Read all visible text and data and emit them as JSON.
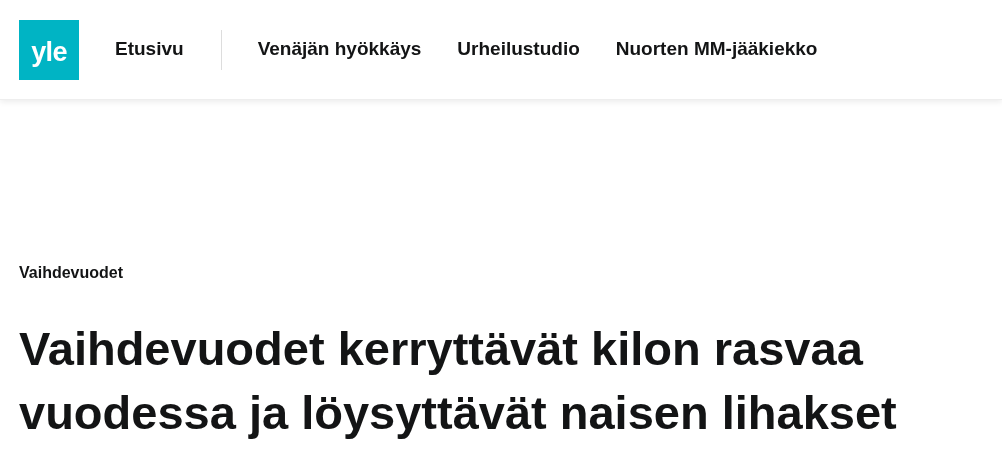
{
  "header": {
    "logo": "yle",
    "nav": [
      {
        "label": "Etusivu",
        "kind": "home"
      },
      {
        "label": "Venäjän hyökkäys",
        "kind": "topic"
      },
      {
        "label": "Urheilustudio",
        "kind": "topic"
      },
      {
        "label": "Nuorten MM-jääkiekko",
        "kind": "topic"
      }
    ]
  },
  "article": {
    "category": "Vaihdevuodet",
    "headline": "Vaihdevuodet kerryttävät kilon rasvaa vuodessa ja löysyttävät naisen lihakset"
  }
}
